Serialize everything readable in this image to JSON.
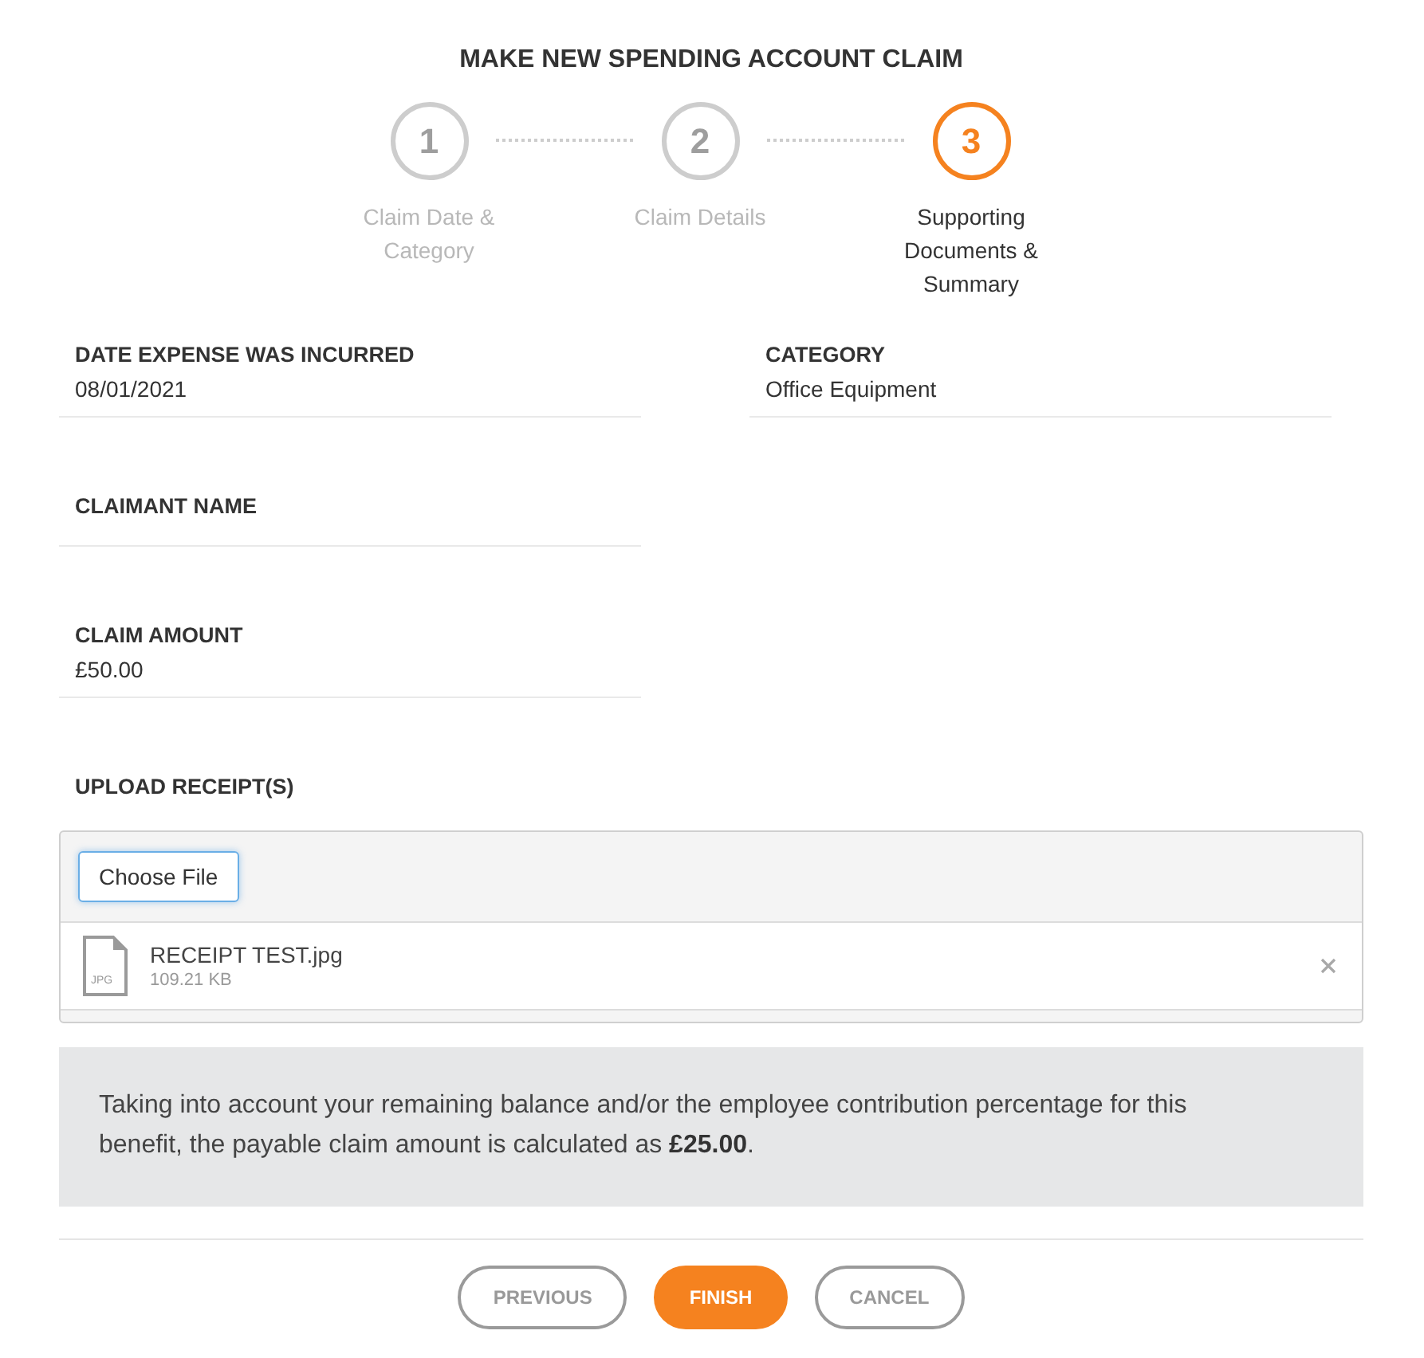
{
  "title": "MAKE NEW SPENDING ACCOUNT CLAIM",
  "steps": [
    {
      "number": "1",
      "label": "Claim Date & Category",
      "selected": false
    },
    {
      "number": "2",
      "label": "Claim Details",
      "selected": false
    },
    {
      "number": "3",
      "label": "Supporting Documents & Summary",
      "selected": true
    }
  ],
  "field_columns": [
    {
      "fields": [
        {
          "label": "DATE EXPENSE WAS INCURRED",
          "value": "08/01/2021"
        },
        {
          "label": "CLAIMANT NAME"
        },
        {
          "label": "CLAIM AMOUNT",
          "value": "£50.00"
        }
      ]
    },
    {
      "fields": [
        {
          "label": "CATEGORY",
          "value": "Office Equipment"
        }
      ]
    }
  ],
  "upload": {
    "label": "UPLOAD RECEIPT(S)",
    "button": "Choose File",
    "files": [
      {
        "type_label": "JPG",
        "name": "RECEIPT TEST.jpg",
        "size": "109.21 KB"
      }
    ]
  },
  "note": "Taking into account your remaining balance and/or the employee contribution percentage for this benefit, the payable claim amount is calculated as **£25.00**.",
  "buttons": [
    {
      "label": "PREVIOUS",
      "kind": "secondary"
    },
    {
      "label": "FINISH",
      "kind": "primary"
    },
    {
      "label": "CANCEL",
      "kind": "secondary"
    }
  ]
}
